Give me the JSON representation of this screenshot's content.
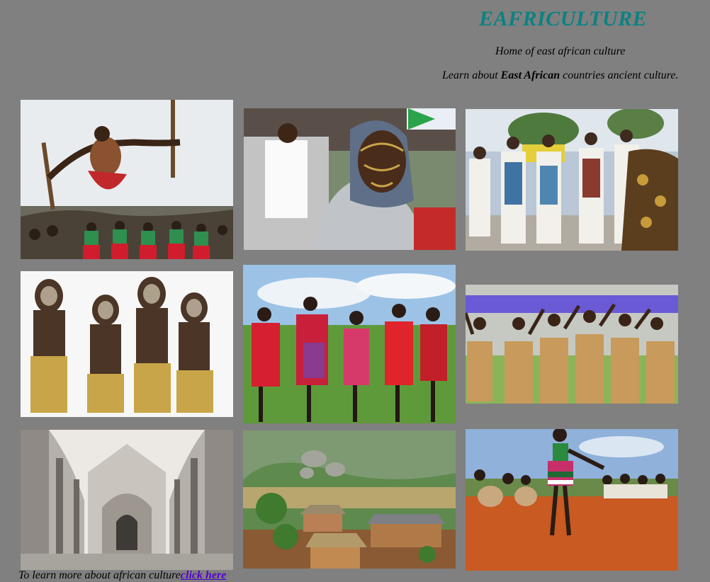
{
  "header": {
    "title": "EAFRICULTURE",
    "tagline": "Home of east african culture",
    "intro_prefix": "Learn about ",
    "intro_bold": "East African",
    "intro_suffix": " countries ancient culture."
  },
  "gallery": {
    "photos": [
      {
        "name": "jumping-dancer-photo"
      },
      {
        "name": "veiled-woman-photo"
      },
      {
        "name": "sword-dancers-photo"
      },
      {
        "name": "painted-children-photo"
      },
      {
        "name": "maasai-group-photo"
      },
      {
        "name": "grass-skirt-dancers-photo"
      },
      {
        "name": "ruined-cathedral-photo"
      },
      {
        "name": "village-landscape-photo"
      },
      {
        "name": "red-earth-dancer-photo"
      }
    ]
  },
  "footer": {
    "text": "To learn more about african culture",
    "link_label": "click here"
  },
  "colors": {
    "background": "#808080",
    "title": "#0b8282",
    "link": "#5500cc"
  }
}
